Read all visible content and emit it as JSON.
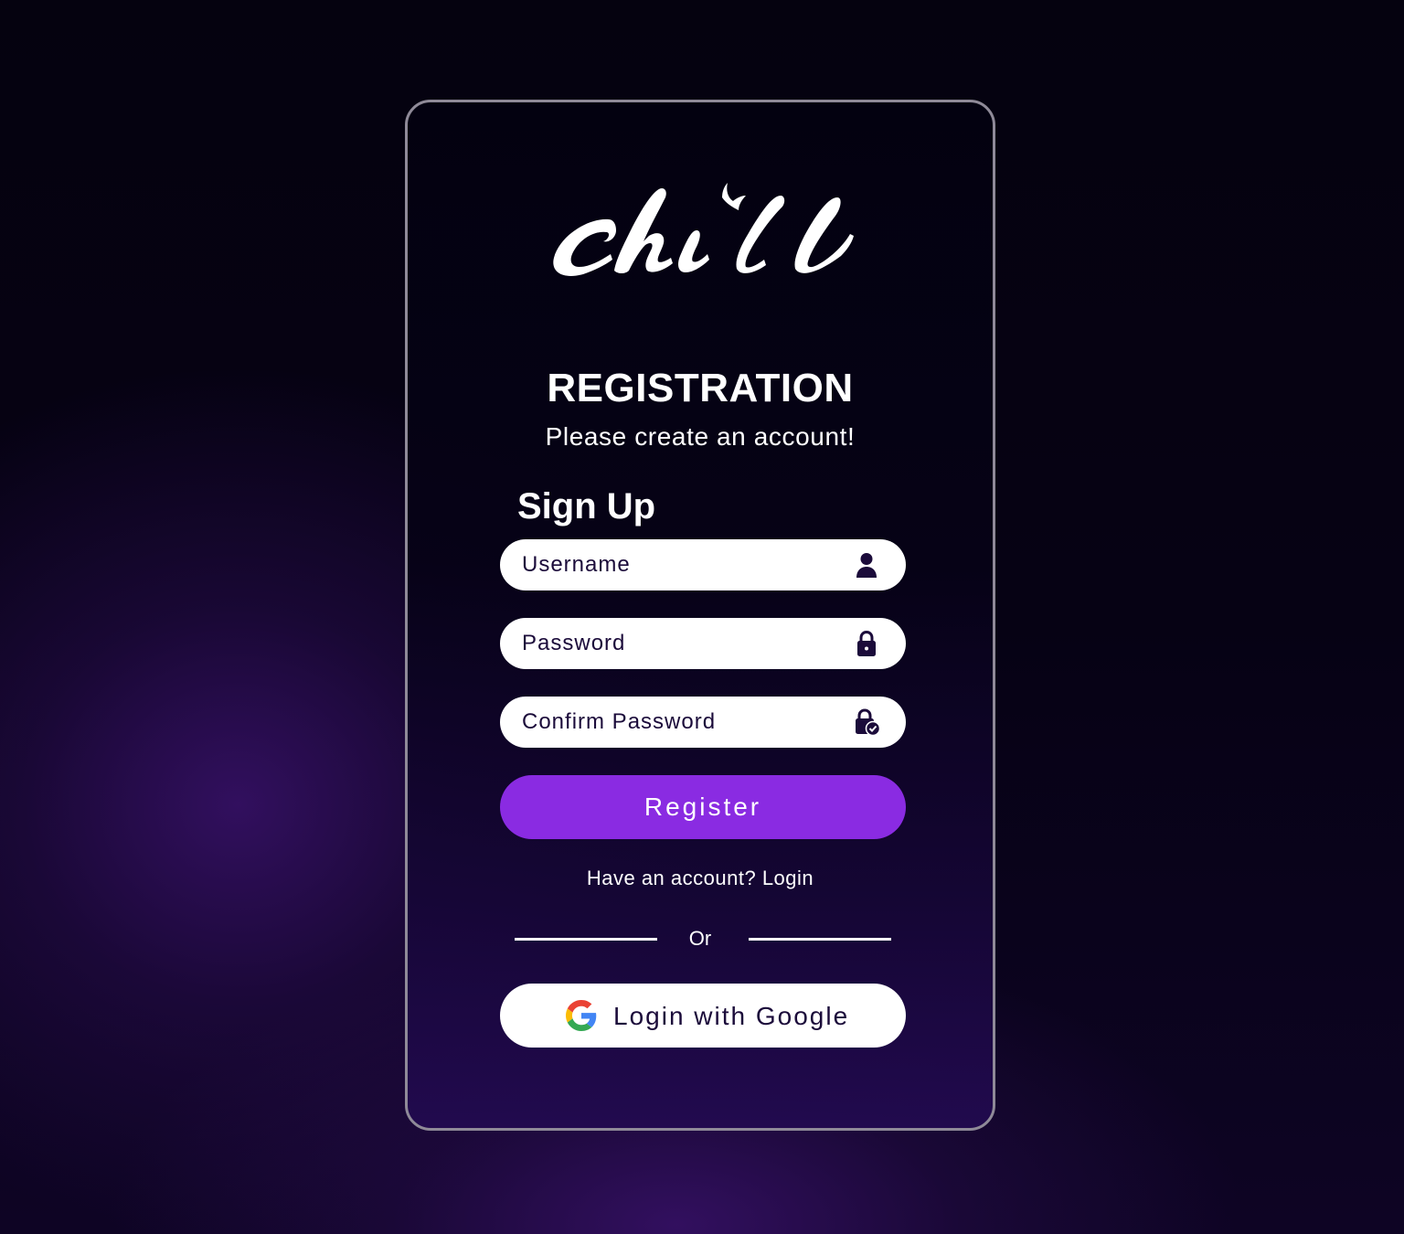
{
  "brand": {
    "logo_text": "chill"
  },
  "header": {
    "title": "REGISTRATION",
    "subtitle": "Please create an account!"
  },
  "form": {
    "heading": "Sign Up",
    "username": {
      "placeholder": "Username",
      "value": "",
      "icon": "user-icon"
    },
    "password": {
      "placeholder": "Password",
      "value": "",
      "icon": "lock-icon"
    },
    "confirm_password": {
      "placeholder": "Confirm Password",
      "value": "",
      "icon": "lock-check-icon"
    },
    "register_label": "Register"
  },
  "footer": {
    "have_account_text": "Have an account?",
    "login_link": "Login",
    "or_text": "Or",
    "google_label": "Login with Google",
    "google_icon": "google-icon"
  },
  "colors": {
    "accent": "#8a2be2",
    "input_text": "#1b0b3a",
    "card_border": "#8f8a98"
  }
}
